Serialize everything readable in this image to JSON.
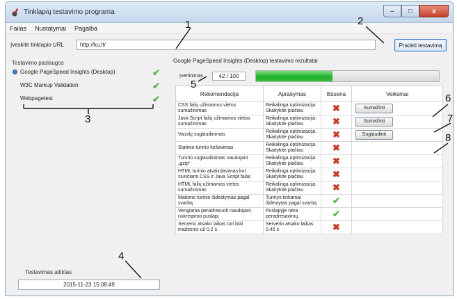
{
  "window": {
    "title": "Tinklapių testavimo programa",
    "controls": {
      "minimize": "–",
      "maximize": "□",
      "close": "x"
    }
  },
  "menu": [
    "Failas",
    "Nustatymai",
    "Pagalba"
  ],
  "url": {
    "label": "Įveskite tinklapio URL",
    "value": "http://ku.lt/",
    "start_button": "Pradėti testavimą"
  },
  "services": {
    "label": "Testavimo paslaugos",
    "items": [
      {
        "name": "Google PageSpeed Insights (Desktop)",
        "selected": true,
        "status": "done"
      },
      {
        "name": "W3C Markup Validation",
        "selected": false,
        "status": "done"
      },
      {
        "name": "Webpagetest",
        "selected": false,
        "status": "done"
      }
    ]
  },
  "test_date": {
    "label": "Testavimas atliktas",
    "value": "2015-11-23 15:08:49"
  },
  "results": {
    "title": "Google PageSpeed Insights (Desktop) testavimo rezultatai",
    "progress_label": "Įvertinimas",
    "progress_value": "42 / 100",
    "progress_fraction": 0.42,
    "columns": [
      "Rekomendacija",
      "Aprašymas",
      "Būsena",
      "Veiksmai"
    ],
    "rows": [
      {
        "rec": "CSS failų užimamos vietos sumažinimas",
        "desc": "Reikalinga optimizacija. Skaitykite plačiau",
        "state": "fail",
        "action": "Sumažinti"
      },
      {
        "rec": "Java Script failų užimamos vietos sumažinimas",
        "desc": "Reikalinga optimizacija. Skaitykite plačiau",
        "state": "fail",
        "action": "Sumažinti"
      },
      {
        "rec": "Vaizdų suglaudinimas",
        "desc": "Reikalinga optimizacija. Skaitykite plačiau",
        "state": "fail",
        "action": "Suglaudinti"
      },
      {
        "rec": "Statinio turinio kešavimas",
        "desc": "Reikalinga optimizacija. Skaitykite plačiau",
        "state": "fail",
        "action": ""
      },
      {
        "rec": "Turinio suglaudinimas naudojant „gzip“",
        "desc": "Reikalinga optimizacija. Skaitykite plačiau",
        "state": "fail",
        "action": ""
      },
      {
        "rec": "HTML turinio atvaizdavimas kol siunčiami CSS ir Java Script failai",
        "desc": "Reikalinga optimizacija. Skaitykite plačiau",
        "state": "fail",
        "action": ""
      },
      {
        "rec": "HTML failų užimamos vietos sumažinimas",
        "desc": "Reikalinga optimizacija. Skaitykite plačiau",
        "state": "fail",
        "action": ""
      },
      {
        "rec": "Matomo turinio išdėstymas pagal svarbą",
        "desc": "Turinys tinkamai išdėstytas pagal svarbą",
        "state": "pass",
        "action": ""
      },
      {
        "rec": "Vengiama peradresuoti naudojant nukreipimo puslapį",
        "desc": "Puslapyje nėra peradresavimų",
        "state": "pass",
        "action": ""
      },
      {
        "rec": "Serverio atsako laikas turi būti mažesnis už 0.2 s",
        "desc": "Serverio atsako laikas 0.45 s",
        "state": "fail",
        "action": ""
      }
    ]
  },
  "annotations": [
    "1",
    "2",
    "3",
    "4",
    "5",
    "6",
    "7",
    "8"
  ],
  "icons": {
    "pass": "✔",
    "fail": "✖",
    "app": "wrench-gear-icon"
  },
  "colors": {
    "progress": "#1fae2a",
    "pass": "#56b548",
    "fail": "#d1361f",
    "button_focus": "#3a7bc8"
  }
}
